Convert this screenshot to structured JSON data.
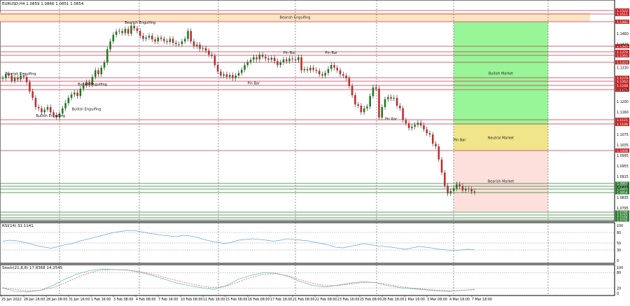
{
  "window": {
    "symbol_line": "EURUSD,H4  1.0859 1.0866 1.0851 1.0854"
  },
  "main": {
    "zones": [
      {
        "kind": "bearish-engulfing-band",
        "label": "Bearish Engulfing",
        "color": "#fde5c3"
      },
      {
        "kind": "bullish-market",
        "label": "Bullish Market",
        "color": "#98f598"
      },
      {
        "kind": "neutral-market",
        "label": "Neutral Market",
        "color": "#f1e58a"
      },
      {
        "kind": "bearish-market",
        "label": "Bearish Market",
        "color": "#fde0dc"
      }
    ],
    "annotations": [
      {
        "text": "Bearish Engulfing",
        "series_index": 46,
        "level": 1.1497
      },
      {
        "text": "Bearish Engulfing",
        "series_index": 6,
        "level": 1.1302
      },
      {
        "text": "Bullish Engulfing",
        "series_index": 30,
        "level": 1.1263
      },
      {
        "text": "Bullish Engulfing",
        "series_index": 28,
        "level": 1.1167
      },
      {
        "text": "Bullish Engulfing",
        "series_index": 16,
        "level": 1.1142
      },
      {
        "text": "Pin Bar",
        "series_index": 96,
        "level": 1.1383
      },
      {
        "text": "Pin Bar",
        "series_index": 110,
        "level": 1.1383
      },
      {
        "text": "Pin Bar",
        "series_index": 84,
        "level": 1.1266
      },
      {
        "text": "Pin Bar",
        "series_index": 130,
        "level": 1.113
      },
      {
        "text": "Pin Bar",
        "series_index": 153,
        "level": 1.105
      }
    ],
    "price_labels": {
      "red": [
        "1.1522",
        "1.1511",
        "1.1482",
        "1.1395",
        "1.1370",
        "1.1361",
        "1.1323",
        "1.1279",
        "1.1262",
        "1.1248",
        "1.1235",
        "1.1121",
        "1.1106",
        "1.1008"
      ],
      "green": [
        "1.0887",
        "1.0871",
        "1.0863",
        "1.0854",
        "1.0789",
        "1.0783",
        "1.0768",
        "1.0762"
      ]
    },
    "axis_ticks": [
      "1.1460",
      "1.1420",
      "1.1330",
      "1.1245",
      "1.1200",
      "1.1160",
      "1.1075",
      "1.1035",
      "1.0995",
      "1.0955",
      "1.0915",
      "1.0875",
      "1.0835",
      "1.0795"
    ]
  },
  "rsi_panel": {
    "header": "RSI(14) 31.1141",
    "ticks": [
      "100",
      "80",
      "50",
      "30",
      "0"
    ]
  },
  "stoch_panel": {
    "header": "Stoch(21,8,8) 17.8368 14.2545",
    "ticks": [
      "100",
      "80",
      "20",
      "0"
    ]
  },
  "time_axis": [
    "25 Jan 2022",
    "26 Jan 16:00",
    "28 Jan 08:00",
    "31 Jan 16:00",
    "1 Feb 16:00",
    "3 Feb 08:00",
    "4 Feb 08:00",
    "7 Feb 16:00",
    "10 Feb 08:00",
    "11 Feb 16:00",
    "15 Feb 08:00",
    "16 Feb 08:00",
    "17 Feb 16:00",
    "21 Feb 08:00",
    "22 Feb 08:00",
    "23 Feb 16:00",
    "25 Feb 08:00",
    "28 Feb 16:00",
    "1 Mar 16:00",
    "3 Mar 08:00",
    "4 Mar 16:00",
    "7 Mar 16:00"
  ],
  "chart_data": {
    "type": "candlestick",
    "instrument": "EURUSD",
    "timeframe": "H4",
    "close_path": [
      1.129,
      1.1305,
      1.13,
      1.128,
      1.1292,
      1.1285,
      1.13,
      1.1295,
      1.1275,
      1.124,
      1.1215,
      1.118,
      1.1175,
      1.116,
      1.117,
      1.118,
      1.116,
      1.115,
      1.114,
      1.1155,
      1.1175,
      1.1195,
      1.1215,
      1.1228,
      1.1235,
      1.1222,
      1.125,
      1.1263,
      1.1275,
      1.1265,
      1.1295,
      1.132,
      1.1305,
      1.133,
      1.135,
      1.14,
      1.143,
      1.1455,
      1.1468,
      1.147,
      1.1462,
      1.1478,
      1.146,
      1.149,
      1.148,
      1.147,
      1.1452,
      1.144,
      1.1445,
      1.1452,
      1.1438,
      1.143,
      1.1445,
      1.144,
      1.1432,
      1.1428,
      1.144,
      1.1425,
      1.142,
      1.142,
      1.143,
      1.144,
      1.147,
      1.143,
      1.1412,
      1.1418,
      1.1402,
      1.1405,
      1.1395,
      1.138,
      1.1375,
      1.134,
      1.1315,
      1.13,
      1.1305,
      1.1295,
      1.1302,
      1.129,
      1.13,
      1.131,
      1.1322,
      1.134,
      1.1352,
      1.136,
      1.137,
      1.1362,
      1.138,
      1.1372,
      1.1365,
      1.136,
      1.1368,
      1.1355,
      1.134,
      1.135,
      1.1362,
      1.1355,
      1.1365,
      1.1362,
      1.1358,
      1.137,
      1.132,
      1.1325,
      1.132,
      1.133,
      1.1322,
      1.1318,
      1.1305,
      1.13,
      1.131,
      1.1325,
      1.134,
      1.133,
      1.132,
      1.1305,
      1.13,
      1.129,
      1.126,
      1.1225,
      1.119,
      1.1185,
      1.116,
      1.1175,
      1.1182,
      1.1222,
      1.1255,
      1.125,
      1.114,
      1.118,
      1.121,
      1.1218,
      1.1212,
      1.1215,
      1.1185,
      1.1175,
      1.113,
      1.1118,
      1.11,
      1.1105,
      1.1112,
      1.112,
      1.111,
      1.1095,
      1.108,
      1.1075,
      1.104,
      1.103,
      1.098,
      1.093,
      1.088,
      1.085,
      1.086,
      1.087,
      1.0885,
      1.0878,
      1.0862,
      1.0868,
      1.0866,
      1.0858,
      1.0855
    ],
    "rsi_path": [
      55,
      58,
      56,
      52,
      48,
      42,
      38,
      35,
      40,
      45,
      48,
      55,
      60,
      65,
      70,
      75,
      80,
      83,
      86,
      85,
      82,
      78,
      75,
      72,
      70,
      68,
      72,
      70,
      66,
      60,
      55,
      52,
      48,
      52,
      58,
      60,
      62,
      60,
      58,
      55,
      58,
      62,
      60,
      58,
      56,
      52,
      48,
      44,
      38,
      36,
      40,
      44,
      48,
      45,
      42,
      40,
      38,
      35,
      32,
      36,
      40,
      38,
      35,
      32,
      30,
      28,
      30,
      32,
      31
    ],
    "stoch_main": [
      20,
      8,
      6,
      12,
      30,
      55,
      75,
      88,
      94,
      92,
      90,
      82,
      70,
      55,
      40,
      30,
      22,
      15,
      30,
      55,
      70,
      80,
      78,
      65,
      45,
      30,
      25,
      32,
      40,
      45,
      42,
      30,
      22,
      18,
      14,
      10,
      8,
      12,
      16
    ],
    "stoch_signal": [
      22,
      15,
      10,
      12,
      22,
      40,
      62,
      80,
      90,
      92,
      90,
      85,
      75,
      62,
      50,
      38,
      28,
      22,
      28,
      45,
      62,
      74,
      76,
      68,
      52,
      38,
      30,
      30,
      36,
      42,
      42,
      35,
      26,
      20,
      16,
      12,
      10,
      12,
      14
    ]
  }
}
